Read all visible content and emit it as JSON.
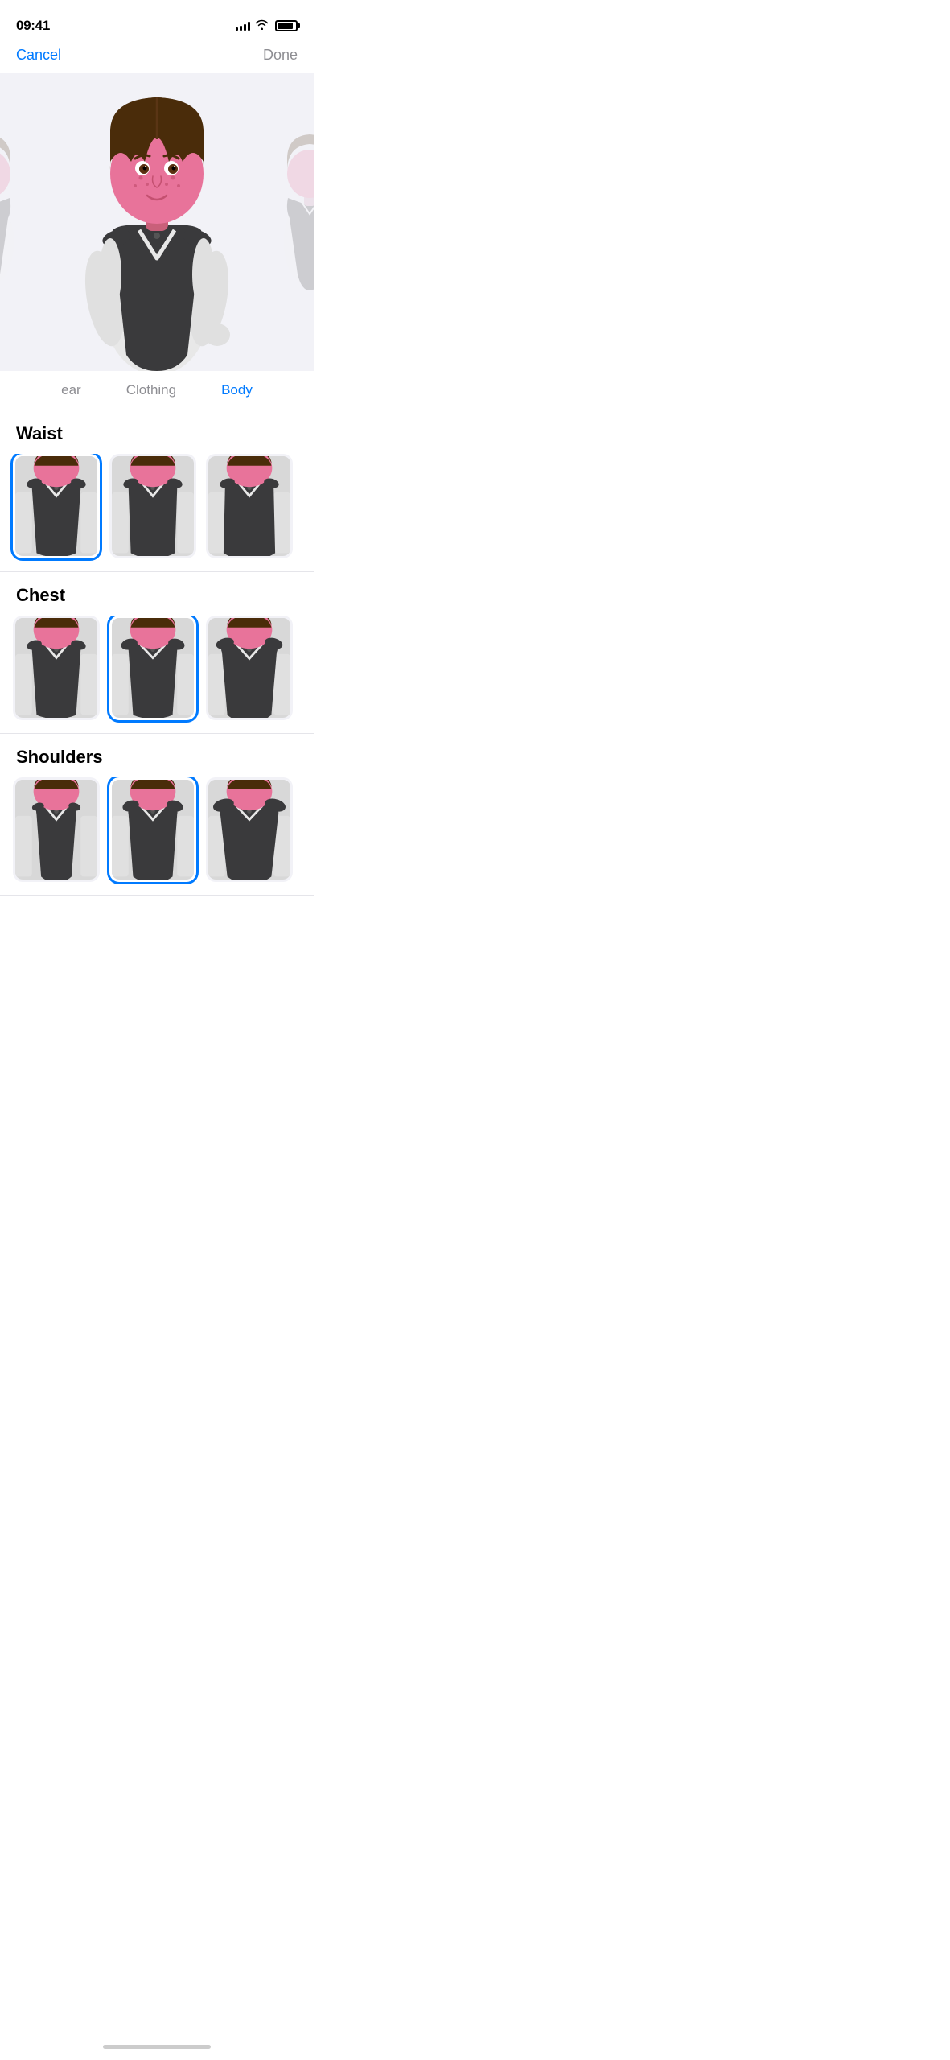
{
  "statusBar": {
    "time": "09:41",
    "signal": [
      3,
      5,
      7,
      9,
      11
    ],
    "battery": 80
  },
  "nav": {
    "cancel": "Cancel",
    "done": "Done"
  },
  "tabs": [
    {
      "id": "ear",
      "label": "ear",
      "active": false
    },
    {
      "id": "clothing",
      "label": "Clothing",
      "active": false
    },
    {
      "id": "body",
      "label": "Body",
      "active": true
    }
  ],
  "sections": [
    {
      "id": "waist",
      "title": "Waist",
      "options": [
        {
          "id": "waist-1",
          "selected": true
        },
        {
          "id": "waist-2",
          "selected": false
        },
        {
          "id": "waist-3",
          "selected": false
        }
      ]
    },
    {
      "id": "chest",
      "title": "Chest",
      "options": [
        {
          "id": "chest-1",
          "selected": false
        },
        {
          "id": "chest-2",
          "selected": true
        },
        {
          "id": "chest-3",
          "selected": false
        }
      ]
    },
    {
      "id": "shoulders",
      "title": "Shoulders",
      "options": [
        {
          "id": "shoulders-1",
          "selected": false
        },
        {
          "id": "shoulders-2",
          "selected": true
        },
        {
          "id": "shoulders-3",
          "selected": false
        }
      ]
    }
  ],
  "colors": {
    "accent": "#007AFF",
    "tabActive": "#007AFF",
    "tabInactive": "#8e8e93",
    "navDone": "#8e8e93",
    "background": "#f2f2f7",
    "vestDark": "#3a3a3c",
    "skinPink": "#e8739a",
    "shirtWhite": "#f5f5f5",
    "hairBrown": "#4a2c0a"
  }
}
